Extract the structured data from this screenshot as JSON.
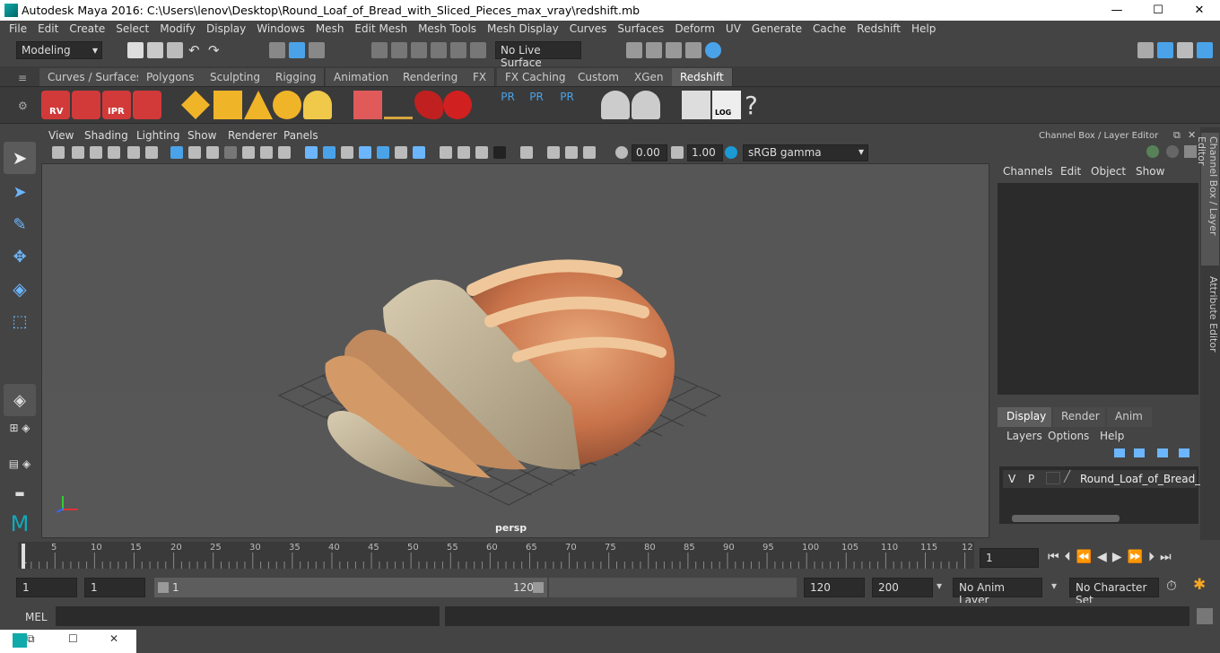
{
  "window": {
    "title": "Autodesk Maya 2016: C:\\Users\\lenov\\Desktop\\Round_Loaf_of_Bread_with_Sliced_Pieces_max_vray\\redshift.mb",
    "minimize": "—",
    "maximize": "☐",
    "close": "✕"
  },
  "menubar": [
    "File",
    "Edit",
    "Create",
    "Select",
    "Modify",
    "Display",
    "Windows",
    "Mesh",
    "Edit Mesh",
    "Mesh Tools",
    "Mesh Display",
    "Curves",
    "Surfaces",
    "Deform",
    "UV",
    "Generate",
    "Cache",
    "Redshift",
    "Help"
  ],
  "status": {
    "mode": "Modeling",
    "live_surface": "No Live Surface"
  },
  "shelf_tabs": [
    "Curves / Surfaces",
    "Polygons",
    "Sculpting",
    "Rigging",
    "Animation",
    "Rendering",
    "FX",
    "FX Caching",
    "Custom",
    "XGen",
    "Redshift"
  ],
  "shelf_active": "Redshift",
  "shelf_labels": {
    "rv": "RV",
    "ipr": "IPR",
    "pr1": "PR",
    "pr2": "PR",
    "pr3": "PR",
    "log": "LOG",
    "help": "?"
  },
  "viewport_menu": [
    "View",
    "Shading",
    "Lighting",
    "Show",
    "Renderer",
    "Panels"
  ],
  "viewport_toolbar": {
    "exposure": "0.00",
    "gamma": "1.00",
    "colorspace": "sRGB gamma"
  },
  "viewport": {
    "camera_label": "persp"
  },
  "channel_box": {
    "title": "Channel Box / Layer Editor",
    "menu": [
      "Channels",
      "Edit",
      "Object",
      "Show"
    ]
  },
  "layer_editor": {
    "tabs": [
      "Display",
      "Render",
      "Anim"
    ],
    "active_tab": "Display",
    "menu": [
      "Layers",
      "Options",
      "Help"
    ],
    "layer": {
      "v": "V",
      "p": "P",
      "name": "Round_Loaf_of_Bread_wit"
    }
  },
  "side_tabs": [
    "Channel Box / Layer Editor",
    "Attribute Editor"
  ],
  "timeline": {
    "ticks": [
      "5",
      "10",
      "15",
      "20",
      "25",
      "30",
      "35",
      "40",
      "45",
      "50",
      "55",
      "60",
      "65",
      "70",
      "75",
      "80",
      "85",
      "90",
      "95",
      "100",
      "105",
      "110",
      "115",
      "12"
    ],
    "first": "1",
    "current_frame": "1"
  },
  "range": {
    "start": "1",
    "playback_start": "1",
    "slider_start": "1",
    "slider_end": "120",
    "playback_end": "120",
    "end": "200",
    "anim_layer": "No Anim Layer",
    "character_set": "No Character Set"
  },
  "mel": {
    "label": "MEL"
  },
  "colors": {
    "accent_blue": "#4aa3e8",
    "redshift_red": "#d23a3a",
    "active_tab": "#5d5d5d"
  }
}
